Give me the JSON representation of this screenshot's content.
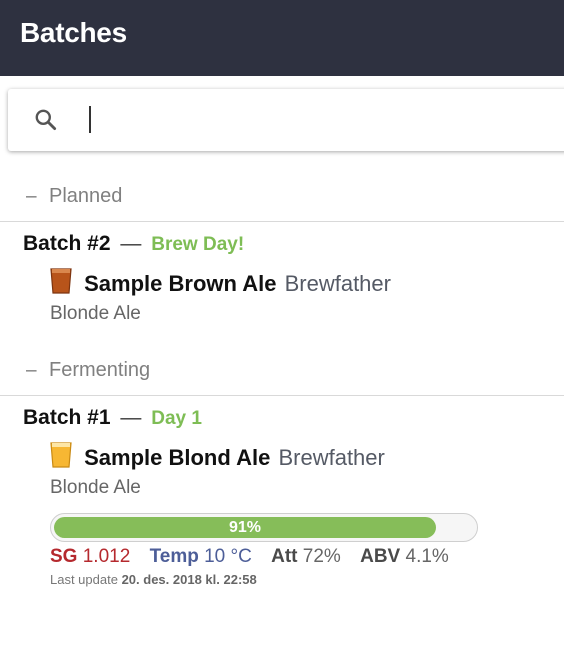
{
  "header": {
    "title": "Batches"
  },
  "search": {
    "placeholder": "",
    "value": ""
  },
  "sections": [
    {
      "collapse_symbol": "–",
      "label": "Planned",
      "batches": [
        {
          "title": "Batch #2",
          "separator": "—",
          "status": "Brew Day!",
          "recipe": "Sample Brown Ale",
          "brewer": "Brewfather",
          "style": "Blonde Ale",
          "glass_color": "#b8541a"
        }
      ]
    },
    {
      "collapse_symbol": "–",
      "label": "Fermenting",
      "batches": [
        {
          "title": "Batch #1",
          "separator": "—",
          "status": "Day 1",
          "recipe": "Sample Blond Ale",
          "brewer": "Brewfather",
          "style": "Blonde Ale",
          "glass_color": "#f7b733",
          "progress": {
            "label": "91%",
            "value": 91
          },
          "stats": {
            "sg_label": "SG",
            "sg_value": "1.012",
            "temp_label": "Temp",
            "temp_value": "10 °C",
            "att_label": "Att",
            "att_value": "72%",
            "abv_label": "ABV",
            "abv_value": "4.1%"
          },
          "last_update_label": "Last update",
          "last_update_value": "20. des. 2018 kl. 22:58"
        }
      ]
    }
  ],
  "colors": {
    "header_bg": "#2e3140",
    "status_green": "#7ebd55",
    "progress_green": "#86bd59",
    "sg_red": "#b5292e",
    "temp_blue": "#4d5e98"
  }
}
